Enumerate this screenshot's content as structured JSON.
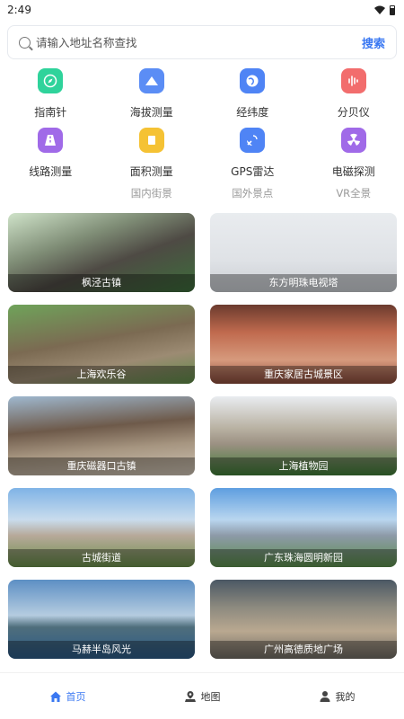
{
  "status_bar": {
    "time": "2:49"
  },
  "search": {
    "placeholder": "请输入地址名称查找",
    "button_label": "搜索"
  },
  "tools": [
    {
      "label": "指南针",
      "icon": "compass-icon",
      "color": "#2fd39b"
    },
    {
      "label": "海拔测量",
      "icon": "mountain-icon",
      "color": "#5b8df5"
    },
    {
      "label": "经纬度",
      "icon": "globe-icon",
      "color": "#4f84f5"
    },
    {
      "label": "分贝仪",
      "icon": "sound-wave-icon",
      "color": "#f26d6d"
    },
    {
      "label": "线路测量",
      "icon": "road-icon",
      "color": "#a06ae8"
    },
    {
      "label": "面积测量",
      "icon": "area-icon",
      "color": "#f5c234"
    },
    {
      "label": "GPS雷达",
      "icon": "satellite-icon",
      "color": "#4f84f5"
    },
    {
      "label": "电磁探测",
      "icon": "radiation-icon",
      "color": "#a06ae8"
    }
  ],
  "tabs": [
    "国内街景",
    "国外景点",
    "VR全景"
  ],
  "places": [
    {
      "name": "枫泾古镇"
    },
    {
      "name": "东方明珠电视塔"
    },
    {
      "name": "上海欢乐谷"
    },
    {
      "name": "重庆家居古城景区"
    },
    {
      "name": "重庆磁器口古镇"
    },
    {
      "name": "上海植物园"
    },
    {
      "name": "古城街道"
    },
    {
      "name": "广东珠海圆明新园"
    },
    {
      "name": "马赫半岛风光"
    },
    {
      "name": "广州高德质地广场"
    }
  ],
  "bottom_nav": {
    "home": "首页",
    "map": "地图",
    "mine": "我的"
  },
  "colors": {
    "accent": "#3a78f2"
  }
}
